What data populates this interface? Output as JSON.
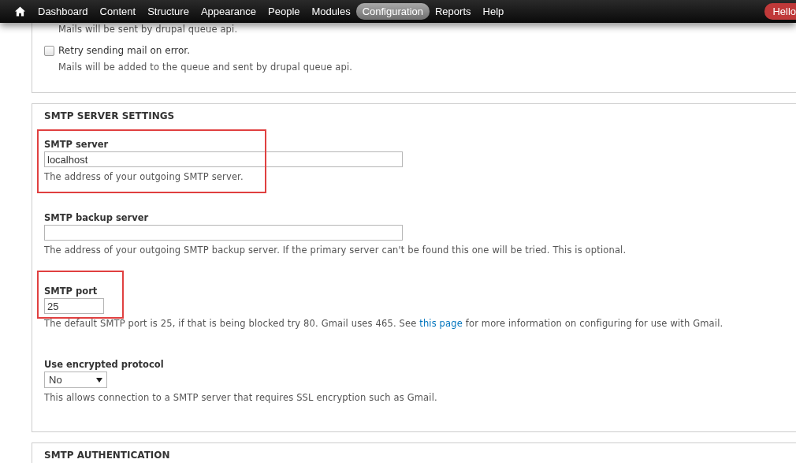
{
  "toolbar": {
    "items": [
      {
        "label": "Dashboard",
        "selected": false
      },
      {
        "label": "Content",
        "selected": false
      },
      {
        "label": "Structure",
        "selected": false
      },
      {
        "label": "Appearance",
        "selected": false
      },
      {
        "label": "People",
        "selected": false
      },
      {
        "label": "Modules",
        "selected": false
      },
      {
        "label": "Configuration",
        "selected": true
      },
      {
        "label": "Reports",
        "selected": false
      },
      {
        "label": "Help",
        "selected": false
      }
    ],
    "greeting": "Hello"
  },
  "queue_section": {
    "items": [
      {
        "kind": "description",
        "text": "Mails will be sent by drupal queue api."
      },
      {
        "kind": "checkbox",
        "label": "Retry sending mail on error.",
        "checked": false,
        "description": "Mails will be added to the queue and sent by drupal queue api."
      }
    ]
  },
  "server_section": {
    "title": "SMTP SERVER SETTINGS",
    "fields": [
      {
        "kind": "text",
        "label": "SMTP server",
        "value": "localhost",
        "highlighted": true,
        "description": "The address of your outgoing SMTP server."
      },
      {
        "kind": "text",
        "label": "SMTP backup server",
        "highlighted": false,
        "description": "The address of your outgoing SMTP backup server. If the primary server can't be found this one will be tried. This is optional."
      },
      {
        "kind": "number",
        "label": "SMTP port",
        "value": "25",
        "highlighted": true,
        "description": [
          {
            "kind": "text",
            "text": "The default SMTP port is 25, if that is being blocked try 80. Gmail uses 465. See "
          },
          {
            "kind": "link",
            "text": "this page"
          },
          {
            "kind": "text",
            "text": " for more information on configuring for use with Gmail."
          }
        ]
      },
      {
        "kind": "select",
        "label": "Use encrypted protocol",
        "value": "No",
        "highlighted": false,
        "description": "This allows connection to a SMTP server that requires SSL encryption such as Gmail."
      }
    ]
  },
  "auth_section": {
    "title": "SMTP AUTHENTICATION"
  }
}
